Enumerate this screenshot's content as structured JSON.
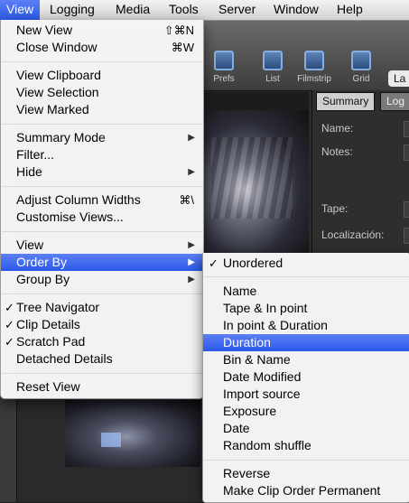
{
  "menubar": {
    "items": [
      "View",
      "Logging",
      "Media",
      "Tools",
      "Server",
      "Window",
      "Help"
    ]
  },
  "view_menu": {
    "items": [
      {
        "label": "New View",
        "shortcut": "⇧⌘N"
      },
      {
        "label": "Close Window",
        "shortcut": "⌘W"
      },
      {
        "label": "View Clipboard"
      },
      {
        "label": "View Selection"
      },
      {
        "label": "View Marked"
      },
      {
        "label": "Summary Mode",
        "submenu": true
      },
      {
        "label": "Filter..."
      },
      {
        "label": "Hide",
        "submenu": true
      },
      {
        "label": "Adjust Column Widths",
        "shortcut": "⌘\\"
      },
      {
        "label": "Customise Views..."
      },
      {
        "label": "View",
        "submenu": true
      },
      {
        "label": "Order By",
        "submenu": true,
        "highlighted": true
      },
      {
        "label": "Group By",
        "submenu": true
      },
      {
        "label": "Tree Navigator",
        "checked": true
      },
      {
        "label": "Clip Details",
        "checked": true
      },
      {
        "label": "Scratch Pad",
        "checked": true
      },
      {
        "label": "Detached Details"
      },
      {
        "label": "Reset View"
      }
    ]
  },
  "order_by_menu": {
    "items": [
      {
        "label": "Unordered",
        "checked": true
      },
      {
        "label": "Name"
      },
      {
        "label": "Tape & In point"
      },
      {
        "label": "In point & Duration"
      },
      {
        "label": "Duration",
        "highlighted": true
      },
      {
        "label": "Bin & Name"
      },
      {
        "label": "Date Modified"
      },
      {
        "label": "Import source"
      },
      {
        "label": "Exposure"
      },
      {
        "label": "Date"
      },
      {
        "label": "Random shuffle"
      },
      {
        "label": "Reverse"
      },
      {
        "label": "Make Clip Order Permanent"
      }
    ]
  },
  "toolbar": {
    "prefs": "Prefs",
    "list": "List",
    "filmstrip": "Filmstrip",
    "grid": "Grid",
    "la": "La"
  },
  "inspector": {
    "tab_summary": "Summary",
    "tab_log": "Log",
    "name_label": "Name:",
    "notes_label": "Notes:",
    "tape_label": "Tape:",
    "localizacion_label": "Localización:"
  },
  "glyphs": {
    "check": "✓",
    "arrow": "▶"
  },
  "colors": {
    "highlight": "#2c5bea",
    "menu_bg": "#f6f6f6"
  }
}
